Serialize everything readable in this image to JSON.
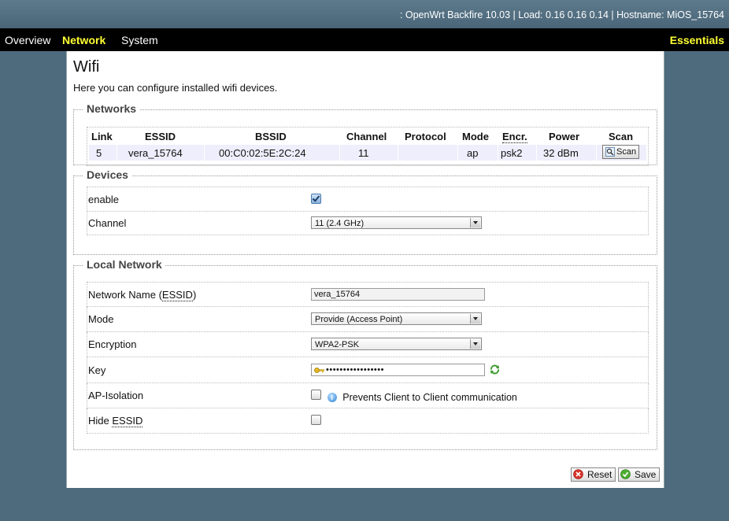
{
  "header": {
    "sysinfo": ": OpenWrt Backfire 10.03 | Load: 0.16 0.16 0.14 | Hostname: MiOS_15764"
  },
  "menu": {
    "items": [
      {
        "label": "Overview"
      },
      {
        "label": "Network"
      },
      {
        "label": "System"
      }
    ],
    "active": "Network",
    "mode": "Essentials"
  },
  "page": {
    "title": "Wifi",
    "description": "Here you can configure installed wifi devices."
  },
  "networks": {
    "legend": "Networks",
    "columns": [
      "Link",
      "ESSID",
      "BSSID",
      "Channel",
      "Protocol",
      "Mode",
      "Encr.",
      "Power",
      "Scan"
    ],
    "rows": [
      {
        "link": "5",
        "essid": "vera_15764",
        "bssid": "00:C0:02:5E:2C:24",
        "channel": "11",
        "protocol": "",
        "mode": "ap",
        "encr": "psk2",
        "power": "32 dBm",
        "scan_label": "Scan"
      }
    ]
  },
  "devices": {
    "legend": "Devices",
    "enable_label": "enable",
    "enable_checked": true,
    "channel_label": "Channel",
    "channel_value": "11 (2.4 GHz)"
  },
  "local_network": {
    "legend": "Local Network",
    "network_name_label_prefix": "Network Name (",
    "network_name_label_abbr": "ESSID",
    "network_name_label_suffix": ")",
    "network_name_value": "vera_15764",
    "mode_label": "Mode",
    "mode_value": "Provide (Access Point)",
    "encryption_label": "Encryption",
    "encryption_value": "WPA2-PSK",
    "key_label": "Key",
    "key_value": "•••••••••••••••••",
    "ap_isolation_label": "AP-Isolation",
    "ap_isolation_hint": "Prevents Client to Client communication",
    "ap_isolation_checked": false,
    "hide_essid_label_prefix": "Hide ",
    "hide_essid_label_abbr": "ESSID",
    "hide_essid_checked": false
  },
  "actions": {
    "reset_label": "Reset",
    "save_label": "Save"
  },
  "colors": {
    "background": "#4e6b7e",
    "menu_active": "#ffff33",
    "row_highlight": "#eeeefc"
  }
}
